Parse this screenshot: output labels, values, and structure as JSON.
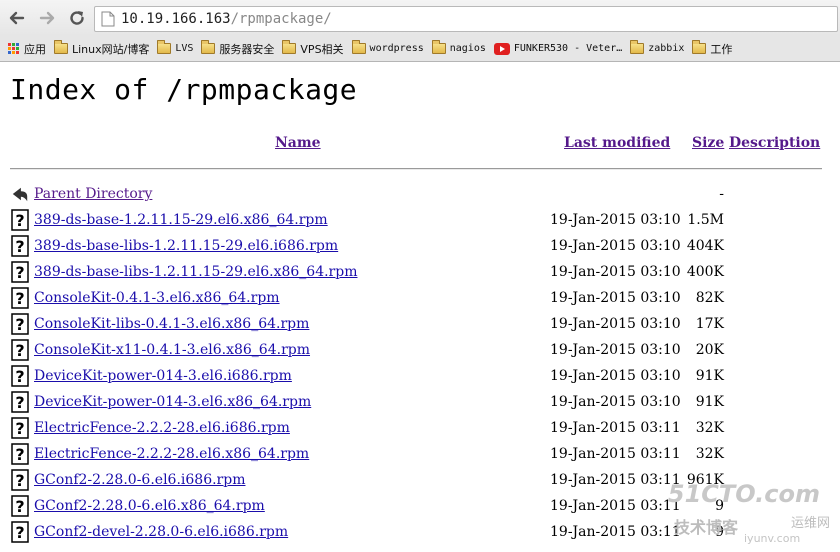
{
  "browser": {
    "url_host": "10.19.166.163",
    "url_path": "/rpmpackage/"
  },
  "bookmarks": [
    {
      "label": "应用",
      "icon": "apps-icon",
      "mono": false
    },
    {
      "label": "Linux网站/博客",
      "icon": "folder-icon",
      "mono": false
    },
    {
      "label": "LVS",
      "icon": "folder-icon",
      "mono": true
    },
    {
      "label": "服务器安全",
      "icon": "folder-icon",
      "mono": false
    },
    {
      "label": "VPS相关",
      "icon": "folder-icon",
      "mono": false
    },
    {
      "label": "wordpress",
      "icon": "folder-icon",
      "mono": true
    },
    {
      "label": "nagios",
      "icon": "folder-icon",
      "mono": true
    },
    {
      "label": "FUNKER530 - Veter…",
      "icon": "youtube-icon",
      "mono": true
    },
    {
      "label": "zabbix",
      "icon": "folder-icon",
      "mono": true
    },
    {
      "label": "工作",
      "icon": "folder-icon",
      "mono": false
    }
  ],
  "page": {
    "title": "Index of /rpmpackage",
    "columns": {
      "name": "Name",
      "last_modified": "Last modified",
      "size": "Size",
      "description": "Description"
    },
    "parent": {
      "name": "Parent Directory",
      "size": "-"
    },
    "files": [
      {
        "name": "389-ds-base-1.2.11.15-29.el6.x86_64.rpm",
        "modified": "19-Jan-2015 03:10",
        "size": "1.5M"
      },
      {
        "name": "389-ds-base-libs-1.2.11.15-29.el6.i686.rpm",
        "modified": "19-Jan-2015 03:10",
        "size": "404K"
      },
      {
        "name": "389-ds-base-libs-1.2.11.15-29.el6.x86_64.rpm",
        "modified": "19-Jan-2015 03:10",
        "size": "400K"
      },
      {
        "name": "ConsoleKit-0.4.1-3.el6.x86_64.rpm",
        "modified": "19-Jan-2015 03:10",
        "size": "82K"
      },
      {
        "name": "ConsoleKit-libs-0.4.1-3.el6.x86_64.rpm",
        "modified": "19-Jan-2015 03:10",
        "size": "17K"
      },
      {
        "name": "ConsoleKit-x11-0.4.1-3.el6.x86_64.rpm",
        "modified": "19-Jan-2015 03:10",
        "size": "20K"
      },
      {
        "name": "DeviceKit-power-014-3.el6.i686.rpm",
        "modified": "19-Jan-2015 03:10",
        "size": "91K"
      },
      {
        "name": "DeviceKit-power-014-3.el6.x86_64.rpm",
        "modified": "19-Jan-2015 03:10",
        "size": "91K"
      },
      {
        "name": "ElectricFence-2.2.2-28.el6.i686.rpm",
        "modified": "19-Jan-2015 03:11",
        "size": "32K"
      },
      {
        "name": "ElectricFence-2.2.2-28.el6.x86_64.rpm",
        "modified": "19-Jan-2015 03:11",
        "size": "32K"
      },
      {
        "name": "GConf2-2.28.0-6.el6.i686.rpm",
        "modified": "19-Jan-2015 03:11",
        "size": "961K"
      },
      {
        "name": "GConf2-2.28.0-6.el6.x86_64.rpm",
        "modified": "19-Jan-2015 03:11",
        "size": "9"
      },
      {
        "name": "GConf2-devel-2.28.0-6.el6.i686.rpm",
        "modified": "19-Jan-2015 03:11",
        "size": "9"
      }
    ]
  },
  "watermark": {
    "brand": "51CTO.com",
    "sub": "技术博客",
    "extra": "运维网",
    "domain": "iyunv.com"
  }
}
